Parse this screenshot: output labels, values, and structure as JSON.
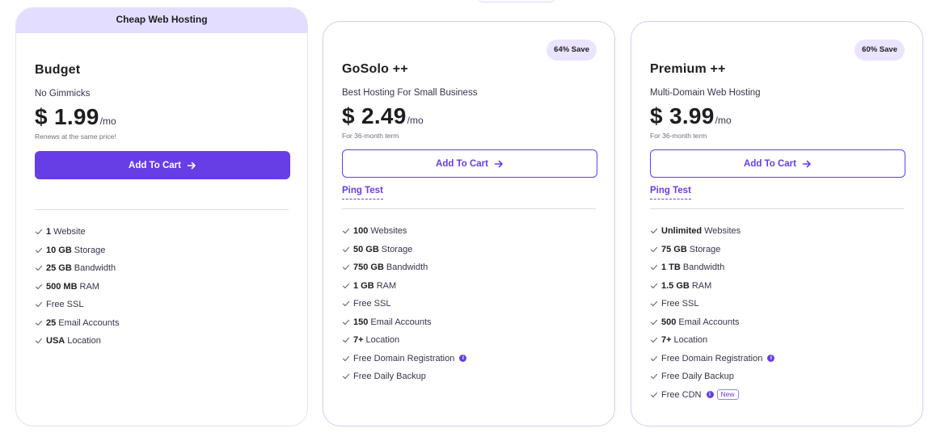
{
  "plans": [
    {
      "banner": "Cheap Web Hosting",
      "name": "Budget",
      "subtitle": "No Gimmicks",
      "price": "$ 1.99",
      "period": "/mo",
      "note": "Renews at the same price!",
      "cta": "Add To Cart",
      "features": [
        {
          "strong": "1",
          "text": "Website"
        },
        {
          "strong": "10 GB",
          "text": "Storage"
        },
        {
          "strong": "25 GB",
          "text": "Bandwidth"
        },
        {
          "strong": "500 MB",
          "text": "RAM"
        },
        {
          "strong": "",
          "text": "Free SSL"
        },
        {
          "strong": "25",
          "text": "Email Accounts"
        },
        {
          "strong": "USA",
          "text": "Location"
        }
      ]
    },
    {
      "badge": "64% Save",
      "name": "GoSolo ++",
      "subtitle": "Best Hosting For Small Business",
      "price": "$ 2.49",
      "period": "/mo",
      "note": "For 36-month term",
      "cta": "Add To Cart",
      "link": "Ping Test",
      "features": [
        {
          "strong": "100",
          "text": "Websites"
        },
        {
          "strong": "50 GB",
          "text": "Storage"
        },
        {
          "strong": "750 GB",
          "text": "Bandwidth"
        },
        {
          "strong": "1 GB",
          "text": "RAM"
        },
        {
          "strong": "",
          "text": "Free SSL"
        },
        {
          "strong": "150",
          "text": "Email Accounts"
        },
        {
          "strong": "7+",
          "text": "Location"
        },
        {
          "strong": "",
          "text": "Free Domain Registration",
          "info": "i"
        },
        {
          "strong": "",
          "text": "Free Daily Backup"
        }
      ]
    },
    {
      "badge": "60% Save",
      "name": "Premium ++",
      "subtitle": "Multi-Domain Web Hosting",
      "price": "$ 3.99",
      "period": "/mo",
      "note": "For 36-month term",
      "cta": "Add To Cart",
      "link": "Ping Test",
      "features": [
        {
          "strong": "Unlimited",
          "text": "Websites"
        },
        {
          "strong": "75 GB",
          "text": "Storage"
        },
        {
          "strong": "1 TB",
          "text": "Bandwidth"
        },
        {
          "strong": "1.5 GB",
          "text": "RAM"
        },
        {
          "strong": "",
          "text": "Free SSL"
        },
        {
          "strong": "500",
          "text": "Email Accounts"
        },
        {
          "strong": "7+",
          "text": "Location"
        },
        {
          "strong": "",
          "text": "Free Domain Registration",
          "info": "i"
        },
        {
          "strong": "",
          "text": "Free Daily Backup"
        },
        {
          "strong": "",
          "text": "Free CDN",
          "info": "i",
          "tag": "New"
        }
      ]
    }
  ],
  "colors": {
    "accent": "#673de6",
    "banner_bg": "#e3ddff",
    "badge_bg": "#ebe4ff",
    "check": "#6d7081"
  },
  "icons": {
    "button_arrow": "arrow-right-icon",
    "feature_mark": "check-icon",
    "info": "info-icon"
  }
}
